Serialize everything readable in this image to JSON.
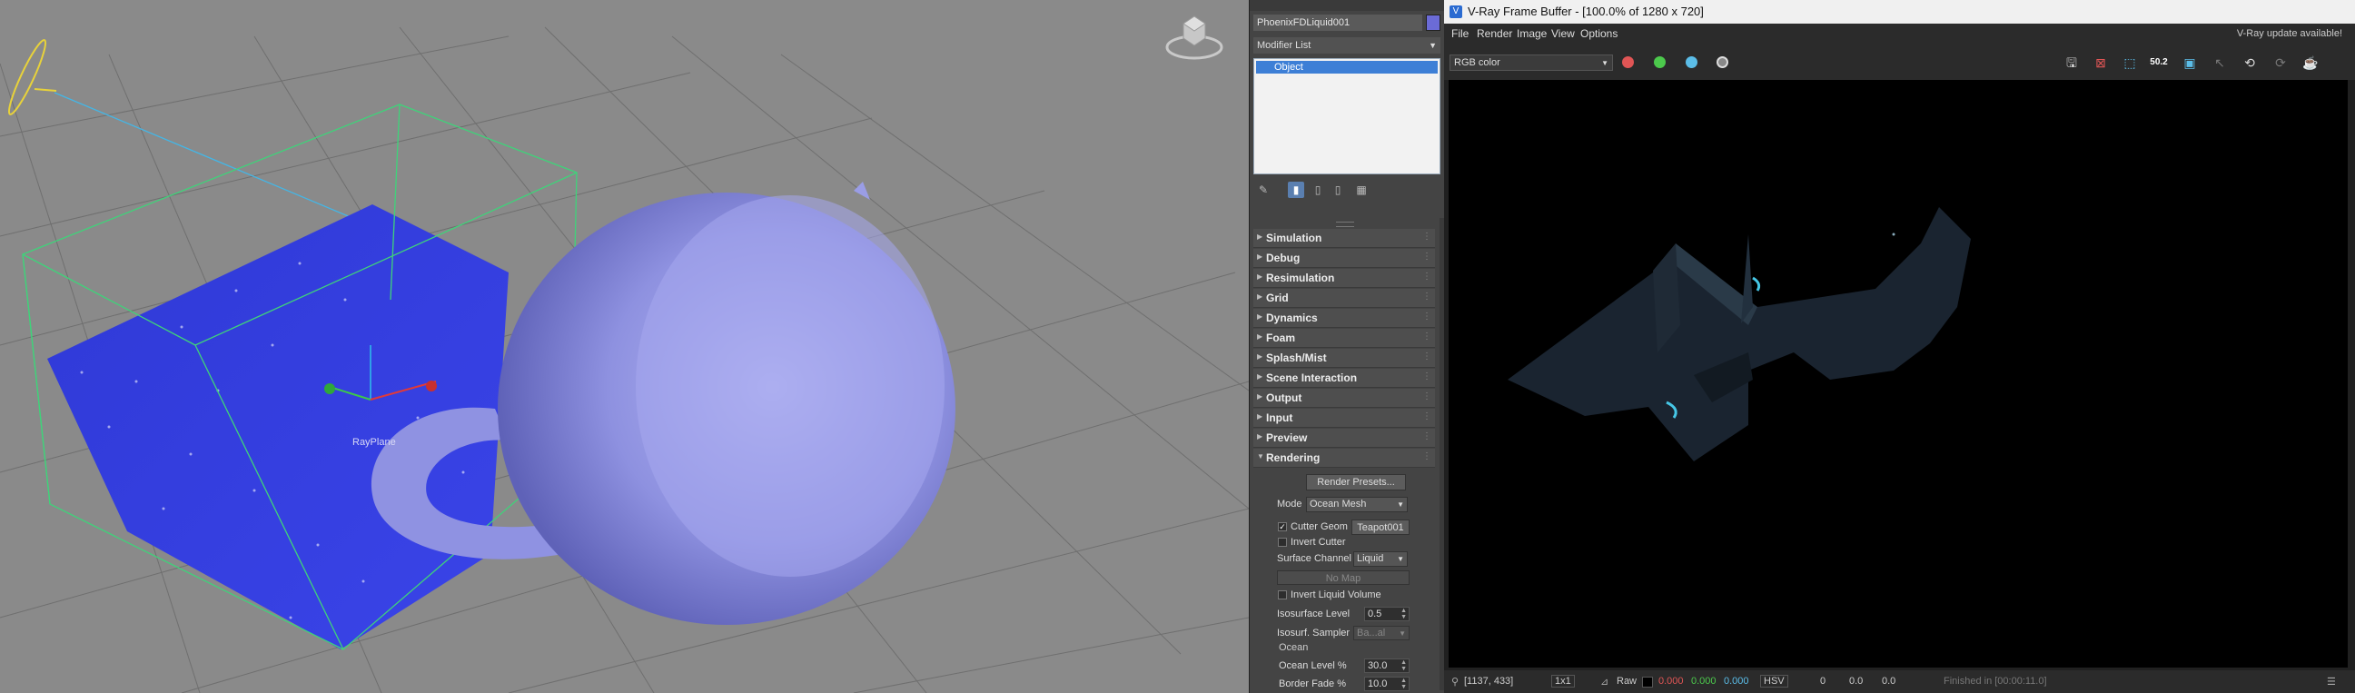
{
  "viewport": {
    "label": "RayPlane"
  },
  "command_panel": {
    "object_name": "PhoenixFDLiquid001",
    "modifier_list": "Modifier List",
    "stack_item": "Object",
    "rollouts": [
      "Simulation",
      "Debug",
      "Resimulation",
      "Grid",
      "Dynamics",
      "Foam",
      "Splash/Mist",
      "Scene Interaction",
      "Output",
      "Input",
      "Preview",
      "Rendering"
    ],
    "rendering": {
      "render_presets": "Render Presets...",
      "mode_label": "Mode",
      "mode_value": "Ocean Mesh",
      "cutter_geom_label": "Cutter Geom",
      "cutter_geom_value": "Teapot001",
      "cutter_geom_checked": true,
      "invert_cutter_label": "Invert Cutter",
      "surface_channel_label": "Surface Channel",
      "surface_channel_value": "Liquid",
      "no_map": "No Map",
      "invert_liquid_volume_label": "Invert Liquid Volume",
      "isosurface_level_label": "Isosurface Level",
      "isosurface_level_value": "0.5",
      "isosurf_sampler_label": "Isosurf. Sampler",
      "isosurf_sampler_value": "Ba...al",
      "ocean_label": "Ocean",
      "ocean_level_label": "Ocean Level %",
      "ocean_level_value": "30.0",
      "border_fade_label": "Border Fade %",
      "border_fade_value": "10.0"
    }
  },
  "vfb": {
    "title": "V-Ray Frame Buffer - [100.0% of 1280 x 720]",
    "menu": [
      "File",
      "Render",
      "Image",
      "View",
      "Options"
    ],
    "update_notice": "V-Ray update available!",
    "channel": "RGB color",
    "channel_dots": [
      "#e05555",
      "#4cc94c",
      "#5bbde8"
    ],
    "toolbar_number": "50.2",
    "status": {
      "coords": "[1137, 433]",
      "zoom": "1x1",
      "raw": "Raw",
      "r": "0.000",
      "g": "0.000",
      "b": "0.000",
      "colorspace": "HSV",
      "h": "0",
      "s": "0.0",
      "v": "0.0",
      "finished": "Finished in [00:00:11.0]"
    }
  }
}
